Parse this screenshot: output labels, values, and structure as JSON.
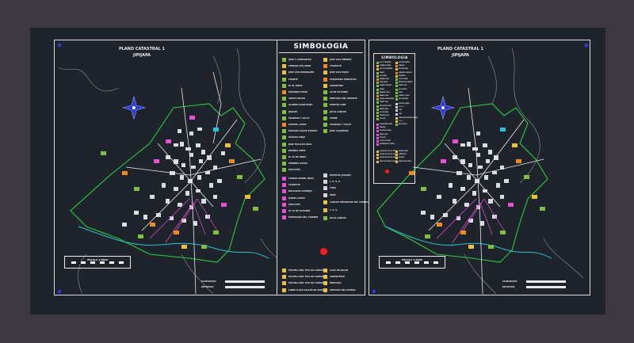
{
  "left_sheet": {
    "title": "PLANO CATASTRAL 1",
    "subtitle": "JIPIJAPA",
    "scale_label": "ESCALA 1:4000",
    "footer_labels": [
      "ELABORADO:",
      "REVISADO:"
    ]
  },
  "legend": {
    "title": "SIMBOLOGIA",
    "col1": [
      {
        "label": "JOSE Y COMUNIDAD",
        "color": "#7fbf3f"
      },
      {
        "label": "CERRAJA VILLAMAR",
        "color": "#e9c23a"
      },
      {
        "label": "JOSE LOIS RODRIGUEZ",
        "color": "#e9c23a"
      },
      {
        "label": "CHANTE",
        "color": "#7fbf3f"
      },
      {
        "label": "EL EL AMOR",
        "color": "#7fbf3f"
      },
      {
        "label": "EDUARDO PIERO",
        "color": "#f08a1c"
      },
      {
        "label": "CRISTO MASIO",
        "color": "#7fbf3f"
      },
      {
        "label": "ALUMNO PONCHADO",
        "color": "#7fbf3f"
      },
      {
        "label": "JIPIJAPA",
        "color": "#7fbf3f"
      },
      {
        "label": "PRADERA Y VALLE",
        "color": "#7fbf3f"
      },
      {
        "label": "MANUEL LOPEZ",
        "color": "#f08a1c"
      },
      {
        "label": "DORADO SAGUE SOPADO",
        "color": "#7fbf3f"
      },
      {
        "label": "ESTADIO VIEJA",
        "color": "#7fbf3f"
      },
      {
        "label": "JOSE ESCALER ORAL",
        "color": "#7fbf3f"
      },
      {
        "label": "BUENOS AIRES",
        "color": "#7fbf3f"
      },
      {
        "label": "EL 10 DE ABRIL",
        "color": "#7fbf3f"
      },
      {
        "label": "PRIMERO ALEZO",
        "color": "#7fbf3f"
      },
      {
        "label": "PESCOTES",
        "color": "#7fbf3f"
      }
    ],
    "col2": [
      {
        "label": "JOSE LUIS MENDEZ",
        "color": "#e9c23a"
      },
      {
        "label": "CHANGITA",
        "color": "#f08a1c"
      },
      {
        "label": "JOSE LUIS PUJAS",
        "color": "#e9c23a"
      },
      {
        "label": "ALEJANDRO GONZALEZ",
        "color": "#f08a1c"
      },
      {
        "label": "ARGENTINA",
        "color": "#e9c23a"
      },
      {
        "label": "10 DE OCTUBRE",
        "color": "#7fbf3f"
      },
      {
        "label": "MERCADO DEL ORIENTE",
        "color": "#7fbf3f"
      },
      {
        "label": "MONTES LEBE",
        "color": "#7fbf3f"
      },
      {
        "label": "JULIO LABADO",
        "color": "#7fbf3f"
      },
      {
        "label": "VERDE",
        "color": "#7fbf3f"
      },
      {
        "label": "SAGRADO Y VALLE",
        "color": "#7fbf3f"
      },
      {
        "label": "JOSE CALDERON",
        "color": "#7fbf3f"
      }
    ],
    "col2b": [
      {
        "label": "HOSPITAL JIPIJAPA",
        "color": "#cfd3d9"
      },
      {
        "label": "L. E. S. E.",
        "color": "#cfd3d9"
      },
      {
        "label": "FORA",
        "color": "#cfd3d9"
      },
      {
        "label": "SEDE",
        "color": "#cfd3d9"
      }
    ],
    "col3": [
      {
        "label": "CIUDAD DANIEL NOVA",
        "color": "#e94fd3"
      },
      {
        "label": "CHANGITA",
        "color": "#e94fd3"
      },
      {
        "label": "BOLEGRAS CONSEJO",
        "color": "#e94fd3"
      },
      {
        "label": "DANIEL LOPEZ",
        "color": "#e94fd3"
      },
      {
        "label": "PESCOTES",
        "color": "#e94fd3"
      },
      {
        "label": "EL 10 DE OCTUBRE",
        "color": "#e94fd3"
      },
      {
        "label": "ESPERANZA DEL CARMEN",
        "color": "#e94fd3"
      }
    ],
    "col3b": [
      {
        "label": "CANCHA DEPORTIVA DEL CENTRO",
        "color": "#e9c23a"
      },
      {
        "label": "L. E. S.",
        "color": "#e9c23a"
      },
      {
        "label": "JULIO LABADO",
        "color": "#7fbf3f"
      }
    ],
    "col4": [
      {
        "label": "ESCUELA DEL TIPO DE CIUDAD",
        "color": "#e9c23a"
      },
      {
        "label": "ESCUELA DEL TIPO DE CIUDAD",
        "color": "#e9c23a"
      },
      {
        "label": "ESCUELA DEL TIPO DE CIUDAD",
        "color": "#e9c23a"
      },
      {
        "label": "LIBRE PLAZA CALLES DE RAMOS",
        "color": "#e9c23a"
      }
    ],
    "col4b": [
      {
        "label": "CASA DE SALUD",
        "color": "#e9c23a"
      },
      {
        "label": "CEMENTERIO",
        "color": "#e9c23a"
      },
      {
        "label": "MERCADO",
        "color": "#e9c23a"
      },
      {
        "label": "SERVICIO DEL PUEBLO",
        "color": "#e9c23a"
      }
    ]
  },
  "right_sheet": {
    "title": "PLANO CATASTRAL 1",
    "subtitle": "JIPIJAPA",
    "legend_title": "SIMBOLOGIA",
    "scale_label": "ESCALA 1:4000",
    "footer_labels": [
      "ELABORADO:",
      "REVISADO:"
    ]
  }
}
